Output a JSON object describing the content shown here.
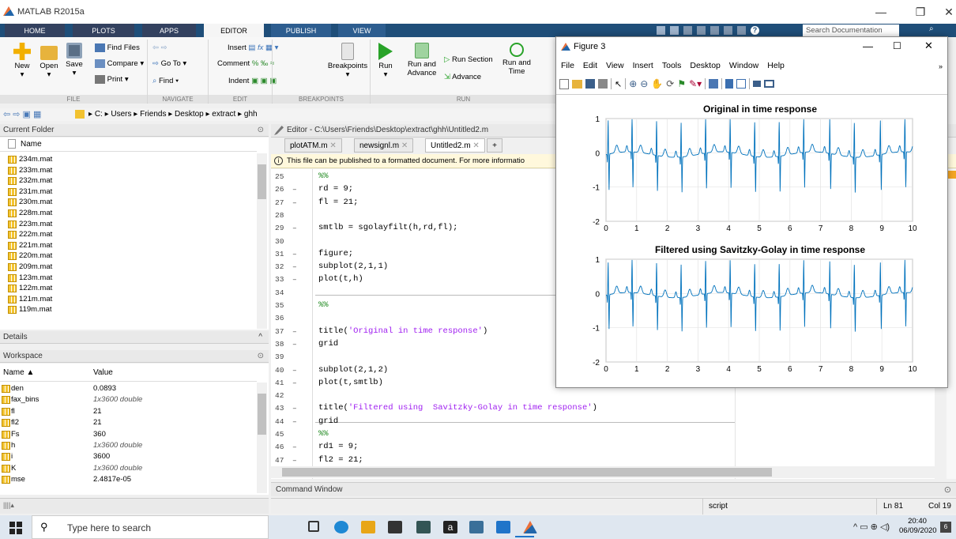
{
  "window": {
    "title": "MATLAB R2015a",
    "min": "—",
    "max": "❐",
    "close": "✕"
  },
  "tabs": [
    "HOME",
    "PLOTS",
    "APPS",
    "EDITOR",
    "PUBLISH",
    "VIEW"
  ],
  "search": {
    "placeholder": "Search Documentation"
  },
  "ribbon": {
    "new": "New",
    "open": "Open",
    "save": "Save",
    "find_files": "Find Files",
    "compare": "Compare ▾",
    "print": "Print ▾",
    "go_to": "Go To ▾",
    "find": "Find ▾",
    "insert": "Insert",
    "comment": "Comment",
    "indent": "Indent",
    "breakpoints": "Breakpoints",
    "run": "Run",
    "run_and_advance": "Run and\nAdvance",
    "run_section": "Run Section",
    "advance": "Advance",
    "run_and_time": "Run and\nTime",
    "sections": [
      "FILE",
      "NAVIGATE",
      "EDIT",
      "BREAKPOINTS",
      "RUN"
    ]
  },
  "path": [
    "C:",
    "Users",
    "Friends",
    "Desktop",
    "extract",
    "ghh"
  ],
  "current_folder": {
    "title": "Current Folder",
    "column": "Name",
    "files": [
      "234m.mat",
      "233m.mat",
      "232m.mat",
      "231m.mat",
      "230m.mat",
      "228m.mat",
      "223m.mat",
      "222m.mat",
      "221m.mat",
      "220m.mat",
      "209m.mat",
      "123m.mat",
      "122m.mat",
      "121m.mat",
      "119m.mat"
    ]
  },
  "details": {
    "title": "Details"
  },
  "workspace": {
    "title": "Workspace",
    "col_name": "Name ▲",
    "col_value": "Value",
    "vars": [
      {
        "name": "den",
        "value": "0.0893",
        "italic": false
      },
      {
        "name": "fax_bins",
        "value": "1x3600 double",
        "italic": true
      },
      {
        "name": "fl",
        "value": "21",
        "italic": false
      },
      {
        "name": "fl2",
        "value": "21",
        "italic": false
      },
      {
        "name": "Fs",
        "value": "360",
        "italic": false
      },
      {
        "name": "h",
        "value": "1x3600 double",
        "italic": true
      },
      {
        "name": "i",
        "value": "3600",
        "italic": false
      },
      {
        "name": "K",
        "value": "1x3600 double",
        "italic": true
      },
      {
        "name": "mse",
        "value": "2.4817e-05",
        "italic": false
      }
    ]
  },
  "editor": {
    "title": "Editor - C:\\Users\\Friends\\Desktop\\extract\\ghh\\Untitled2.m",
    "tabs": [
      "plotATM.m",
      "newsignl.m",
      "Untitled2.m"
    ],
    "notice": "This file can be published to a formatted document. For more informatio",
    "lines": [
      {
        "n": "25",
        "mark": "",
        "code": "%%",
        "kind": "cmt"
      },
      {
        "n": "26",
        "mark": "–",
        "code": "rd = 9;",
        "kind": ""
      },
      {
        "n": "27",
        "mark": "–",
        "code": "fl = 21;",
        "kind": ""
      },
      {
        "n": "28",
        "mark": "",
        "code": "",
        "kind": ""
      },
      {
        "n": "29",
        "mark": "–",
        "code": "smtlb = sgolayfilt(h,rd,fl);",
        "kind": ""
      },
      {
        "n": "30",
        "mark": "",
        "code": "",
        "kind": ""
      },
      {
        "n": "31",
        "mark": "–",
        "code": "figure;",
        "kind": ""
      },
      {
        "n": "32",
        "mark": "–",
        "code": "subplot(2,1,1)",
        "kind": ""
      },
      {
        "n": "33",
        "mark": "–",
        "code": "plot(t,h)",
        "kind": ""
      },
      {
        "n": "34",
        "mark": "",
        "code": "",
        "kind": ""
      },
      {
        "n": "35",
        "mark": "",
        "code": "%%",
        "kind": "cmt"
      },
      {
        "n": "36",
        "mark": "",
        "code": "",
        "kind": ""
      },
      {
        "n": "37",
        "mark": "–",
        "code": "title('Original in time response')",
        "kind": "title1"
      },
      {
        "n": "38",
        "mark": "–",
        "code": "grid",
        "kind": ""
      },
      {
        "n": "39",
        "mark": "",
        "code": "",
        "kind": ""
      },
      {
        "n": "40",
        "mark": "–",
        "code": "subplot(2,1,2)",
        "kind": ""
      },
      {
        "n": "41",
        "mark": "–",
        "code": "plot(t,smtlb)",
        "kind": ""
      },
      {
        "n": "42",
        "mark": "",
        "code": "",
        "kind": ""
      },
      {
        "n": "43",
        "mark": "–",
        "code": "title('Filtered using  Savitzky-Golay in time response')",
        "kind": "title2"
      },
      {
        "n": "44",
        "mark": "–",
        "code": "grid",
        "kind": ""
      },
      {
        "n": "45",
        "mark": "",
        "code": "%%",
        "kind": "cmt"
      },
      {
        "n": "46",
        "mark": "–",
        "code": "rd1 = 9;",
        "kind": ""
      },
      {
        "n": "47",
        "mark": "–",
        "code": "fl2 = 21;",
        "kind": ""
      }
    ]
  },
  "command_window": {
    "title": "Command Window"
  },
  "statusbar": {
    "mode": "script",
    "ln": "Ln  81",
    "col": "Col  19"
  },
  "figure": {
    "title": "Figure 3",
    "menu": [
      "File",
      "Edit",
      "View",
      "Insert",
      "Tools",
      "Desktop",
      "Window",
      "Help"
    ],
    "plot1_title": "Original in time response",
    "plot2_title": "Filtered using  Savitzky-Golay in time response",
    "xticks": [
      "0",
      "1",
      "2",
      "3",
      "4",
      "5",
      "6",
      "7",
      "8",
      "9",
      "10"
    ],
    "yticks": [
      "1",
      "0",
      "-1",
      "-2"
    ]
  },
  "chart_data": [
    {
      "type": "line",
      "title": "Original in time response",
      "xlim": [
        0,
        10
      ],
      "ylim": [
        -2,
        1
      ],
      "grid": true,
      "beat_times": [
        0.07,
        0.85,
        1.65,
        2.45,
        3.25,
        4.05,
        4.85,
        5.65,
        6.45,
        7.3,
        8.1,
        8.95,
        9.75
      ],
      "series": [
        {
          "values_desc": "ECG signal h",
          "color": "#0072bd"
        }
      ]
    },
    {
      "type": "line",
      "title": "Filtered using  Savitzky-Golay in time response",
      "xlim": [
        0,
        10
      ],
      "ylim": [
        -2,
        1
      ],
      "grid": true,
      "beat_times": [
        0.07,
        0.85,
        1.65,
        2.45,
        3.25,
        4.05,
        4.85,
        5.65,
        6.45,
        7.3,
        8.1,
        8.95,
        9.75
      ],
      "series": [
        {
          "values_desc": "smtlb",
          "color": "#0072bd"
        }
      ]
    }
  ],
  "taskbar": {
    "search_placeholder": "Type here to search",
    "time": "20:40",
    "date": "06/09/2020"
  }
}
